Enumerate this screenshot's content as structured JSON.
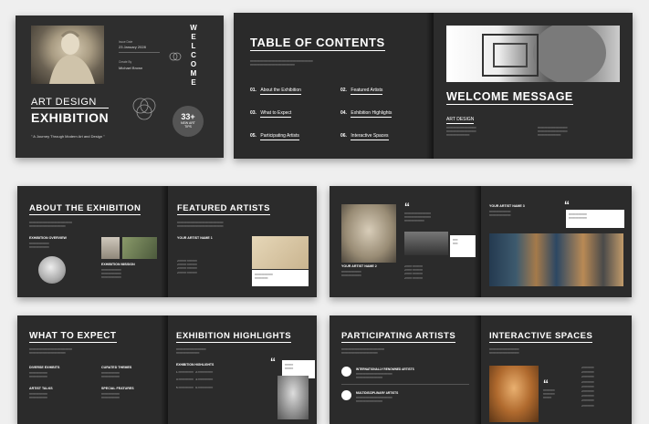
{
  "cover": {
    "issue_date_label": "Issue Date",
    "issue_date": "23 January 2028",
    "created_by_label": "Create By",
    "author": "Michael Brown",
    "welcome_vertical": "WELCOME",
    "title_line1": "ART DESIGN",
    "title_line2": "EXHIBITION",
    "tagline": "\" A Journey Through Modern Art and Design \"",
    "badge_number": "33+",
    "badge_line1": "NEW ART",
    "badge_line2": "TIPS"
  },
  "toc": {
    "title": "TABLE OF CONTENTS",
    "items": [
      {
        "num": "01.",
        "label": "About the Exhibition"
      },
      {
        "num": "02.",
        "label": "Featured Artists"
      },
      {
        "num": "03.",
        "label": "What to Expect"
      },
      {
        "num": "04.",
        "label": "Exhibition Highlights"
      },
      {
        "num": "05.",
        "label": "Participating Artists"
      },
      {
        "num": "06.",
        "label": "Interactive Spaces"
      }
    ]
  },
  "welcome": {
    "title": "WELCOME MESSAGE",
    "section": "ART DESIGN"
  },
  "about": {
    "title": "ABOUT THE EXHIBITION",
    "overview": "EXHIBITION OVERVIEW",
    "mission": "EXHIBITION MISSION"
  },
  "featured": {
    "title": "FEATURED ARTISTS",
    "artist1": "YOUR ARTIST NAME 1"
  },
  "artists_spread": {
    "artist2": "YOUR ARTIST NAME 2",
    "artist3": "YOUR ARTIST NAME 3"
  },
  "expect": {
    "title": "WHAT TO EXPECT",
    "items": [
      "DIVERSE EXHIBITS",
      "CURATED THEMES",
      "ARTIST TALKS",
      "SPECIAL FEATURES"
    ]
  },
  "highlights": {
    "title": "EXHIBITION HIGHLIGHTS",
    "sub": "EXHIBITION HIGHLIGHTS"
  },
  "participating": {
    "title": "PARTICIPATING ARTISTS",
    "row1": "INTERNATIONALLY RENOWNED ARTISTS",
    "row2": "MULTIDISCIPLINARY ARTISTS"
  },
  "interactive": {
    "title": "INTERACTIVE SPACES"
  }
}
